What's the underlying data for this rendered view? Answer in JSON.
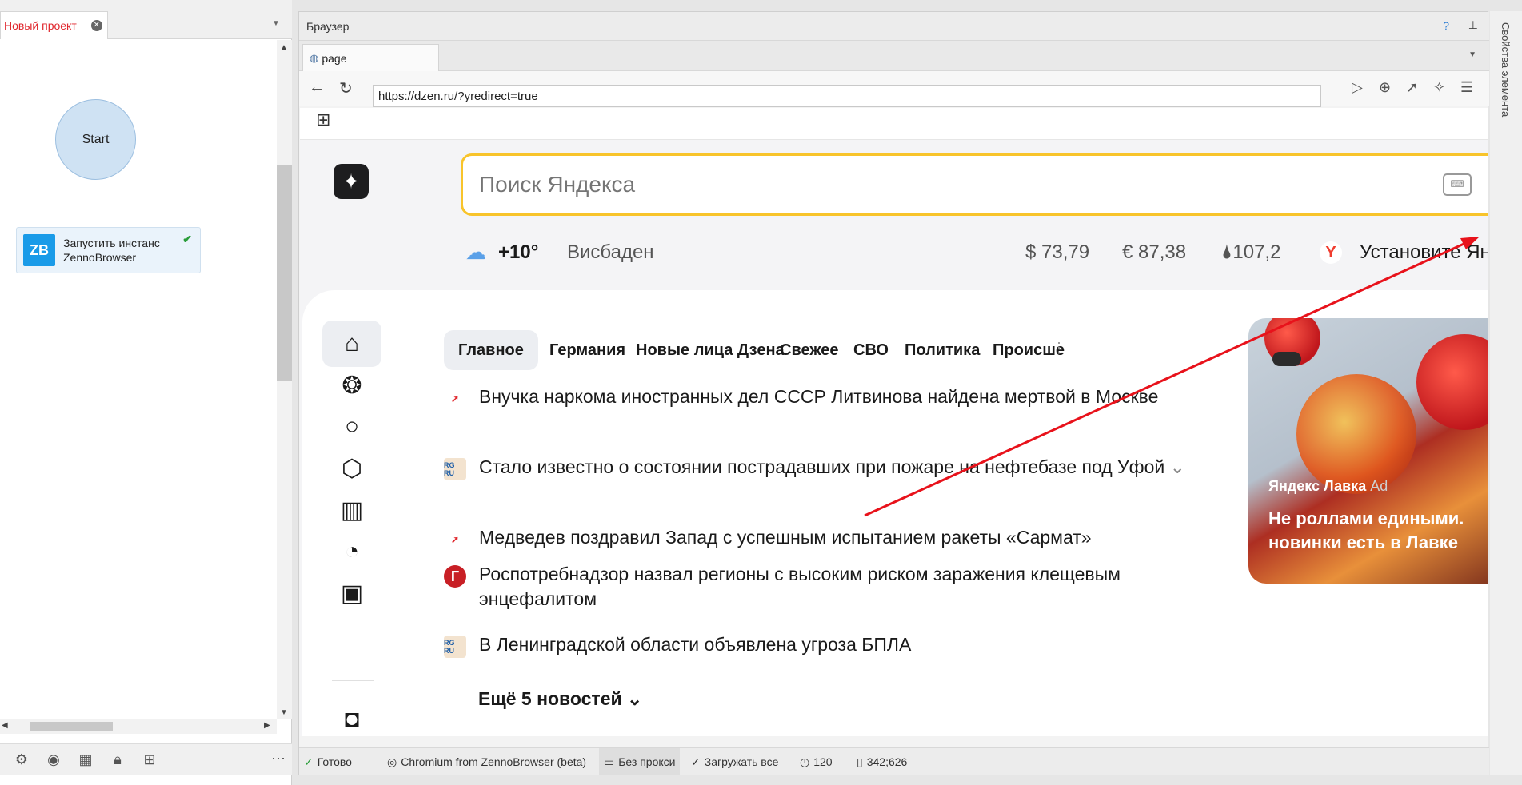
{
  "left_panel": {
    "tab_title": "Новый проект",
    "start_node": "Start",
    "action_node": {
      "icon_text": "ZB",
      "label": "Запустить инстанс ZennoBrowser"
    },
    "toolbar_icons": [
      "settings-icon",
      "user-icon",
      "grid-icon",
      "lock-icon",
      "add-icon"
    ]
  },
  "browser": {
    "panel_title": "Браузер",
    "help": "?",
    "page_tab": "page",
    "url": "https://dzen.ru/?yredirect=true"
  },
  "yandex": {
    "search_placeholder": "Поиск Яндекса",
    "weather_temp": "+10°",
    "city": "Висбаден",
    "usd": "$ 73,79",
    "eur": "€ 87,38",
    "oil": "107,2",
    "promo": "Установите Ян",
    "topics": [
      "Главное",
      "Германия",
      "Новые лица Дзена",
      "Свежее",
      "СВО",
      "Политика",
      "Происше"
    ],
    "news": [
      {
        "source": "arrow",
        "text": "Внучка наркома иностранных дел СССР Литвинова найдена мертвой в Москве"
      },
      {
        "source": "RG RU",
        "text": "Стало известно о состоянии пострадавших при пожаре на нефтебазе под Уфой"
      },
      {
        "source": "arrow",
        "text": "Медведев поздравил Запад с успешным испытанием ракеты «Сармат»"
      },
      {
        "source": "Г",
        "text": "Роспотребнадзор назвал регионы с высоким риском заражения клещевым энцефалитом"
      },
      {
        "source": "RG RU",
        "text": "В Ленинградской области объявлена угроза БПЛА"
      }
    ],
    "more_news": "Ещё 5 новостей",
    "ad": {
      "brand": "Яндекс Лавка",
      "ad_mark": "Ad",
      "text": "Не роллами едиными. новинки есть в Лавке"
    }
  },
  "statusbar": {
    "ready": "Готово",
    "engine": "Chromium from ZennoBrowser (beta)",
    "proxy": "Без прокси",
    "load": "Загружать все",
    "timeout": "120",
    "coords": "342;626"
  },
  "right_strip": {
    "label": "Свойства элемента"
  },
  "colors": {
    "accent_red": "#e0262c",
    "search_border": "#f8c42b",
    "zb_blue": "#1a9be8"
  }
}
